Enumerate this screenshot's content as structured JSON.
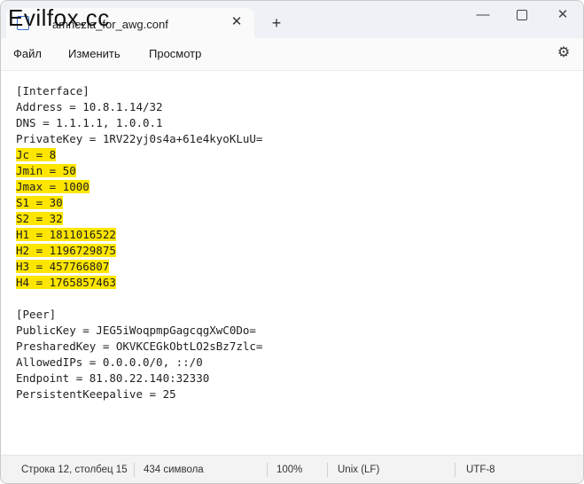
{
  "watermark": "Evilfox.cc",
  "tab": {
    "title": "amnezia_for_awg.conf",
    "close_glyph": "✕"
  },
  "new_tab_glyph": "+",
  "window_controls": {
    "minimize": "—",
    "close": "✕"
  },
  "menu": {
    "file": "Файл",
    "edit": "Изменить",
    "view": "Просмотр"
  },
  "editor": {
    "lines": [
      {
        "text": "[Interface]",
        "highlight": false
      },
      {
        "text": "Address = 10.8.1.14/32",
        "highlight": false
      },
      {
        "text": "DNS = 1.1.1.1, 1.0.0.1",
        "highlight": false
      },
      {
        "text": "PrivateKey = 1RV22yj0s4a+61e4kyoKLuU=",
        "highlight": false
      },
      {
        "text": "Jc = 8",
        "highlight": true
      },
      {
        "text": "Jmin = 50",
        "highlight": true
      },
      {
        "text": "Jmax = 1000",
        "highlight": true
      },
      {
        "text": "S1 = 30",
        "highlight": true
      },
      {
        "text": "S2 = 32",
        "highlight": true
      },
      {
        "text": "H1 = 1811016522",
        "highlight": true
      },
      {
        "text": "H2 = 1196729875",
        "highlight": true
      },
      {
        "text": "H3 = 457766807",
        "highlight": true
      },
      {
        "text": "H4 = 1765857463",
        "highlight": true
      },
      {
        "text": "",
        "highlight": false
      },
      {
        "text": "[Peer]",
        "highlight": false
      },
      {
        "text": "PublicKey = JEG5iWoqpmpGagcqgXwC0Do=",
        "highlight": false
      },
      {
        "text": "PresharedKey = OKVKCEGkObtLO2sBz7zlc=",
        "highlight": false
      },
      {
        "text": "AllowedIPs = 0.0.0.0/0, ::/0",
        "highlight": false
      },
      {
        "text": "Endpoint = 81.80.22.140:32330",
        "highlight": false
      },
      {
        "text": "PersistentKeepalive = 25",
        "highlight": false
      }
    ],
    "highlight_color": "#ffe600"
  },
  "status": {
    "position": "Строка 12, столбец 15",
    "chars": "434 символа",
    "zoom": "100%",
    "eol": "Unix (LF)",
    "encoding": "UTF-8"
  },
  "icons": {
    "tab": "notepad-icon",
    "settings": "gear-icon"
  }
}
